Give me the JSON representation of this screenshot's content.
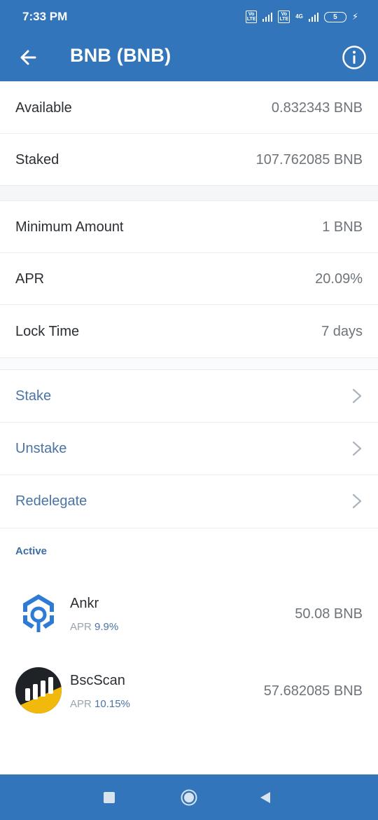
{
  "status_bar": {
    "time": "7:33 PM",
    "network": "4G",
    "battery": "5"
  },
  "header": {
    "title": "BNB (BNB)",
    "back_icon": "arrow-left-icon",
    "info_icon": "info-circle-icon"
  },
  "balances": [
    {
      "label": "Available",
      "value": "0.832343 BNB"
    },
    {
      "label": "Staked",
      "value": "107.762085 BNB"
    }
  ],
  "details": [
    {
      "label": "Minimum Amount",
      "value": "1 BNB"
    },
    {
      "label": "APR",
      "value": "20.09%"
    },
    {
      "label": "Lock Time",
      "value": "7 days"
    }
  ],
  "actions": [
    {
      "label": "Stake"
    },
    {
      "label": "Unstake"
    },
    {
      "label": "Redelegate"
    }
  ],
  "active_section": {
    "title": "Active",
    "validators": [
      {
        "name": "Ankr",
        "apr_label": "APR",
        "apr_value": "9.9%",
        "amount": "50.08 BNB",
        "logo_colors": [
          "#2d7bd6",
          "#ffffff"
        ]
      },
      {
        "name": "BscScan",
        "apr_label": "APR",
        "apr_value": "10.15%",
        "amount": "57.682085 BNB",
        "logo_colors": [
          "#1f2328",
          "#f0b90b"
        ]
      }
    ]
  },
  "colors": {
    "brand_blue": "#3375bb",
    "link_blue": "#4a74a5",
    "separator": "#eceff1"
  }
}
